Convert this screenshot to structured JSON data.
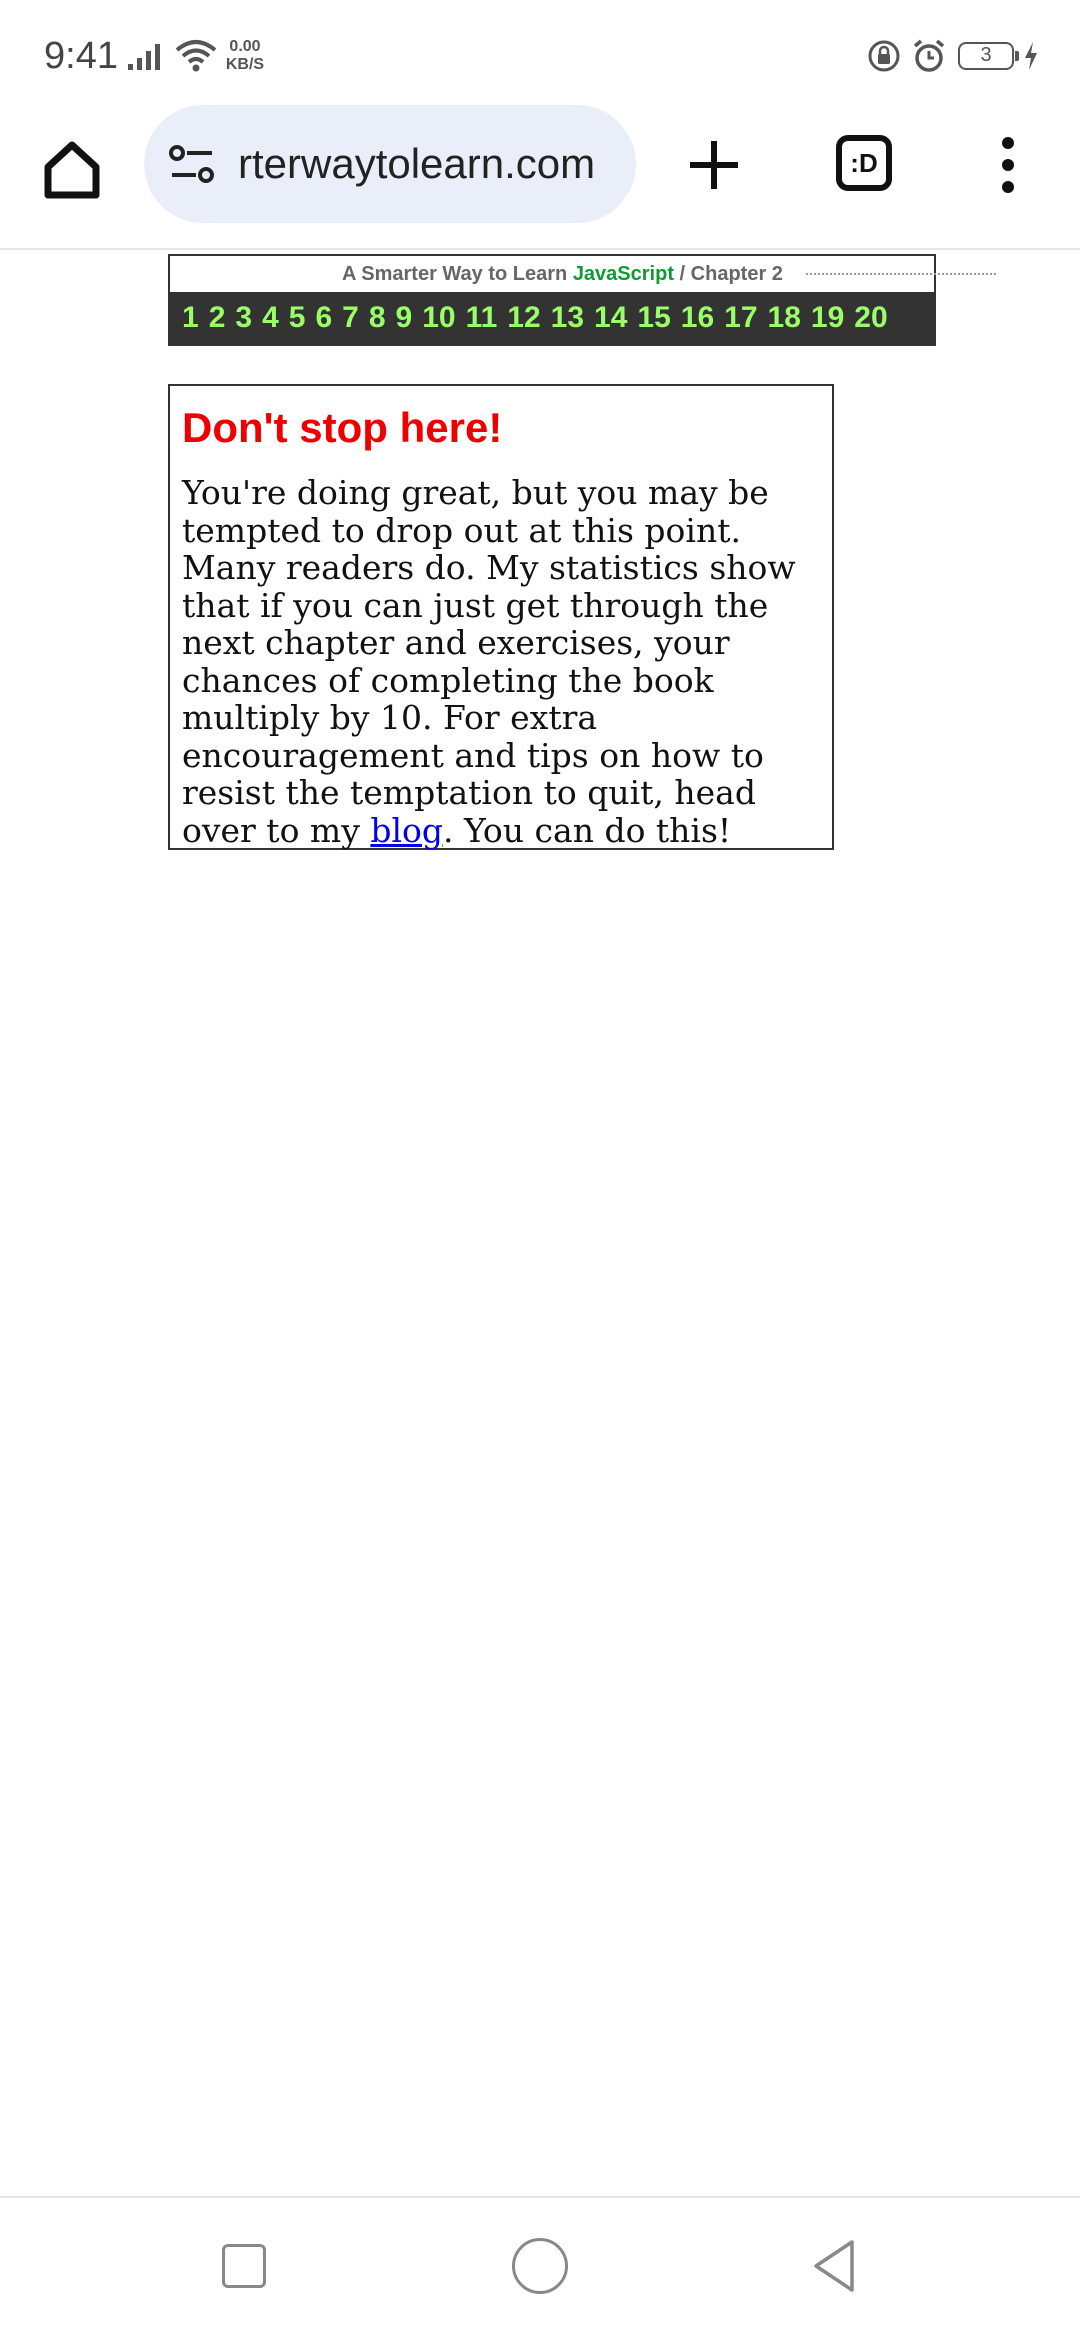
{
  "status_bar": {
    "time": "9:41",
    "net_speed_value": "0.00",
    "net_speed_unit": "KB/S",
    "battery_level": "3"
  },
  "browser": {
    "url": "rterwaytolearn.com",
    "tabs_button_label": ":D",
    "icons": {
      "home": "home-icon",
      "tune": "tune-icon",
      "new_tab": "plus-icon",
      "tabs": "tabs-icon",
      "menu": "more-vert-icon"
    }
  },
  "page": {
    "book_title_prefix": "A Smarter Way to Learn ",
    "book_title_highlight": "JavaScript",
    "book_title_separator": " / ",
    "book_title_chapter": "Chapter 2",
    "chapters": [
      "1",
      "2",
      "3",
      "4",
      "5",
      "6",
      "7",
      "8",
      "9",
      "10",
      "11",
      "12",
      "13",
      "14",
      "15",
      "16",
      "17",
      "18",
      "19",
      "20"
    ],
    "notice": {
      "heading": "Don't stop here!",
      "body_before_link": "You're doing great, but you may be tempted to drop out at this point. Many readers do. My statistics show that if you can just get through the next chapter and exercises, your chances of completing the book multiply by 10. For extra encouragement and tips on how to resist the temptation to quit, head over to my ",
      "link_text": "blog",
      "body_after_link": ". You can do this!"
    },
    "colors": {
      "heading": "#ee0000",
      "javascript": "#119933",
      "chapter_numbers": "#99ff66",
      "chapter_bar": "#333333",
      "link": "#0000ee"
    }
  },
  "nav_bar": {
    "icons": {
      "recents": "square-icon",
      "home": "circle-icon",
      "back": "triangle-back-icon"
    }
  }
}
